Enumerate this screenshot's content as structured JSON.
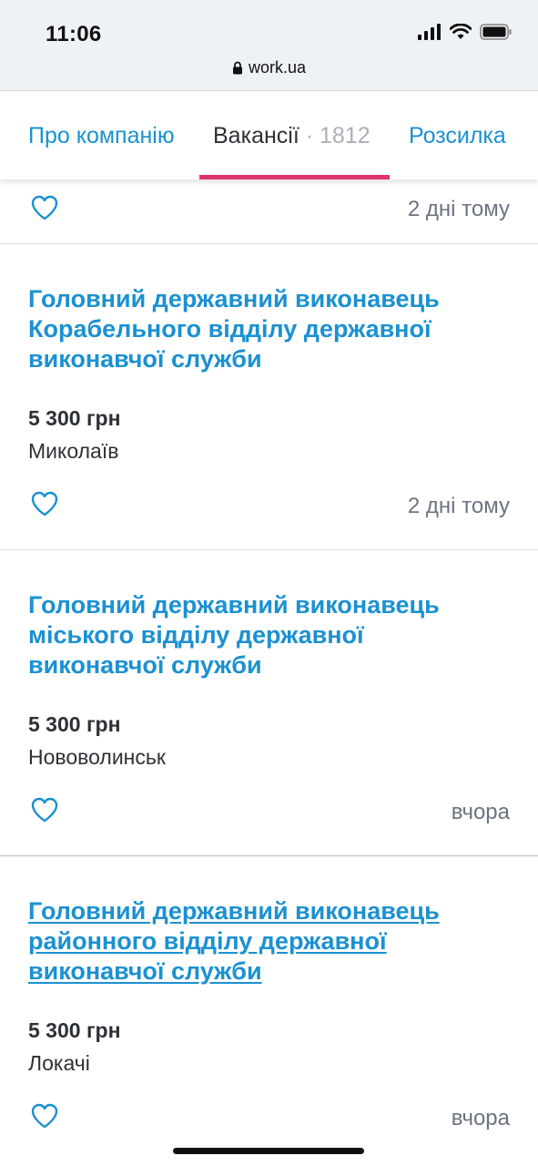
{
  "status_bar": {
    "time": "11:06"
  },
  "browser": {
    "url": "work.ua"
  },
  "tabs": {
    "about": "Про компанію",
    "vacancies": "Вакансії",
    "vacancies_count": "· 1812",
    "mailing": "Розсилка"
  },
  "first_item": {
    "date": "2 дні тому"
  },
  "vacancies": [
    {
      "title": "Головний державний виконавець Корабельного відділу державної виконавчої служби",
      "salary": "5 300 грн",
      "city": "Миколаїв",
      "date": "2 дні тому"
    },
    {
      "title": "Головний державний виконавець міського відділу державної виконавчої служби",
      "salary": "5 300 грн",
      "city": "Нововолинськ",
      "date": "вчора"
    },
    {
      "title": "Головний державний виконавець районного відділу державної виконавчої служби",
      "salary": "5 300 грн",
      "city": "Локачі",
      "date": "вчора"
    }
  ],
  "colors": {
    "link": "#1b91d1",
    "accent": "#e0346a",
    "text": "#2d3136",
    "muted": "#6b7380"
  }
}
